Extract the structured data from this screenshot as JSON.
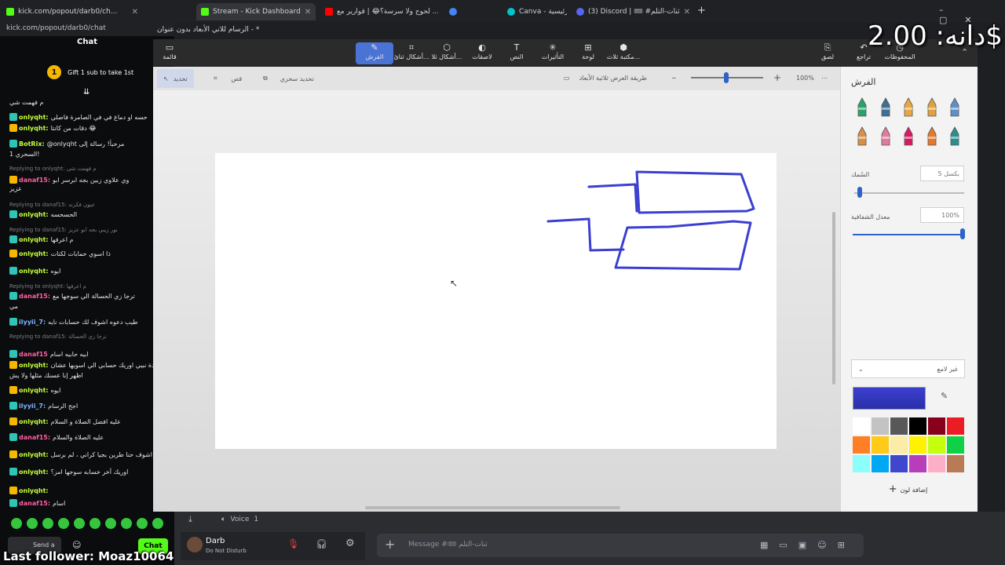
{
  "browser": {
    "tabs": [
      {
        "label": "kick.com/popout/darb0/ch...",
        "color": "#53fc18"
      },
      {
        "label": "Stream - Kick Dashboard",
        "color": "#53fc18"
      },
      {
        "label": "لحوج ولا سرسة؟😂 | قوارير مع ...",
        "color": "#ff0000"
      },
      {
        "label": "",
        "color": "#4285f4"
      },
      {
        "label": "Canva - الرئيسية",
        "color": "#00c4cc"
      },
      {
        "label": "(3) Discord | 🎟 #ثنات-التلم",
        "color": "#5865f2"
      }
    ],
    "kick_url": "kick.com/popout/darb0/chat"
  },
  "kick_chat": {
    "title": "Chat",
    "gift_count": "1",
    "gift_text": "Gift 1 sub to take 1st",
    "messages": [
      {
        "user": "",
        "text": "م فهمت شي",
        "reply": false
      },
      {
        "user": "onlyqht:",
        "text": "حسه او دماغ في في الصامرة فاصلي",
        "reply": false
      },
      {
        "user": "onlyqht:",
        "text": "دقات من كانتا 😂",
        "reply": false
      },
      {
        "user": "BotRix:",
        "text": "@onlyqht مرحباً! رسالة إلى",
        "reply": false
      },
      {
        "user": "",
        "text": "السحري 1!",
        "reply": false
      },
      {
        "user": "",
        "text": "Replying to onlyqht: م فهمت شي",
        "reply": true
      },
      {
        "user": "danaf15:",
        "text": "وي علاوي زبين بجه ابرسر ابو",
        "reply": false
      },
      {
        "user": "",
        "text": "عزيز",
        "reply": false
      },
      {
        "user": "",
        "text": "Replying to danaf15: عيون فكرنه",
        "reply": true
      },
      {
        "user": "onlyqht:",
        "text": "الحسحسه",
        "reply": false
      },
      {
        "user": "",
        "text": "Replying to danaf15: نور زيبي بجه ابو عزيز",
        "reply": true
      },
      {
        "user": "onlyqht:",
        "text": "م اعرفها",
        "reply": false
      },
      {
        "user": "onlyqht:",
        "text": "ذا اسوي حمابات لكنات",
        "reply": false
      },
      {
        "user": "onlyqht:",
        "text": "ايوه",
        "reply": false
      },
      {
        "user": "",
        "text": "Replying to onlyqht: م اعرفها",
        "reply": true
      },
      {
        "user": "danaf15:",
        "text": "ترجا زي الحسالة الي سوجها مع",
        "reply": false
      },
      {
        "user": "",
        "text": "مي",
        "reply": false
      },
      {
        "user": "ilyyii_7:",
        "text": "طيب دعوه اشوف لك حسابات نايه",
        "reply": false
      },
      {
        "user": "",
        "text": "Replying to danaf15: ترجا زي الحسالة",
        "reply": true
      },
      {
        "user": "danaf15",
        "text": "ابيه حابيه اسام",
        "reply": false
      },
      {
        "user": "onlyqht:",
        "text": "ي عودة نبيي اوريك حسابي الي اسويها عشان",
        "reply": false
      },
      {
        "user": "",
        "text": "اظهر إنا عسنك مثلها ولا يش",
        "reply": false
      },
      {
        "user": "onlyqht:",
        "text": "ايوه",
        "reply": false
      },
      {
        "user": "ilyyii_7:",
        "text": "اجح الرسام",
        "reply": false
      },
      {
        "user": "onlyqht:",
        "text": "عليه افضل الصلاة و السلام",
        "reply": false
      },
      {
        "user": "danaf15:",
        "text": "عليه الصلاة والسلام",
        "reply": false
      },
      {
        "user": "onlyqht:",
        "text": "اشوف حنا طرين بجيا كراني ، لم برسل",
        "reply": false
      },
      {
        "user": "onlyqht:",
        "text": "اوريك آخر خسابه سوجها امز؟",
        "reply": false
      },
      {
        "user": "onlyqht:",
        "text": "",
        "reply": false
      },
      {
        "user": "danaf15:",
        "text": "اسام",
        "reply": false
      }
    ],
    "send_label": "Send a",
    "chat_button": "Chat",
    "last_follower": "Last follower: Moaz10064"
  },
  "paint": {
    "title": "الرسام للاني الأبعاد بدون عنوان - *",
    "ribbon": [
      {
        "label": "قائمة",
        "icon": "▭"
      },
      {
        "label": "الفرش",
        "icon": "✎",
        "selected": true
      },
      {
        "label": "أشكال ثنائ...",
        "icon": "⌗"
      },
      {
        "label": "أشكال ثلا...",
        "icon": "⬡"
      },
      {
        "label": "لاصقات",
        "icon": "◐"
      },
      {
        "label": "النص",
        "icon": "T"
      },
      {
        "label": "التأثيرات",
        "icon": "✳"
      },
      {
        "label": "لوحة",
        "icon": "⊞"
      },
      {
        "label": "مكتبة ثلاث...",
        "icon": "⬢"
      },
      {
        "label": "المحفوظات",
        "icon": "◷"
      },
      {
        "label": "تراجع",
        "icon": "↶"
      },
      {
        "label": "لصق",
        "icon": "⎘"
      }
    ],
    "subtools": {
      "select": "تحديد",
      "crop": "قص",
      "magic_select": "تحديد سحري",
      "view_mode": "طريقة العرض ثلاثية الأبعاد",
      "zoom": "100%"
    },
    "panel": {
      "title": "الفرش",
      "thickness_label": "السُمك",
      "thickness_value": "5 بكسل",
      "opacity_label": "معدل الشفافية",
      "opacity_value": "100%",
      "finish_label": "غير لامع",
      "add_color": "إضافة لون",
      "current_color": "#3b3fd0",
      "thickness_fraction": 0.05,
      "opacity_fraction": 1.0,
      "brush_colors": [
        "#2aa36b",
        "#3e6f94",
        "#e8a742",
        "#e3a13d",
        "#5e8fc9",
        "#d98f48",
        "#e27aa0",
        "#d81b60",
        "#e6792b",
        "#2b8f8f"
      ],
      "palette": [
        "#ffffff",
        "#c3c3c3",
        "#585858",
        "#000000",
        "#88001b",
        "#ec1c24",
        "#ff7f27",
        "#ffca18",
        "#fdeca6",
        "#fff200",
        "#c4ff0e",
        "#0ed145",
        "#8cfffb",
        "#00a8f3",
        "#3f48cc",
        "#b83dba",
        "#ffaec8",
        "#b97a56"
      ]
    },
    "drawing_color": "#3b3fd0"
  },
  "overlay": {
    "donation": "دانه: 2.00$"
  },
  "discord": {
    "voice_label": "Voice",
    "voice_count": "1",
    "user_name": "Darb",
    "user_status": "Do Not Disturb",
    "message_placeholder": "Message #🎟 ثنات-التلم"
  }
}
